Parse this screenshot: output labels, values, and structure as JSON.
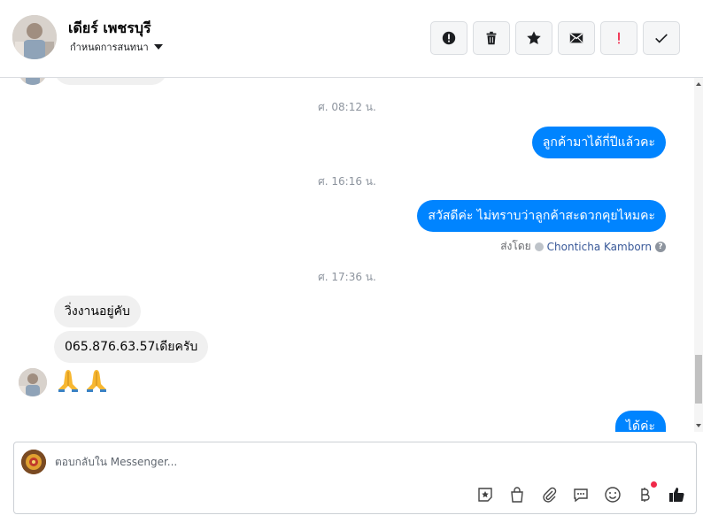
{
  "header": {
    "title": "เดียร์ เพชรบุรี",
    "subtitle": "กำหนดการสนทนา",
    "actions": [
      {
        "name": "alert-icon"
      },
      {
        "name": "trash-icon"
      },
      {
        "name": "star-icon"
      },
      {
        "name": "mail-icon"
      },
      {
        "name": "exclamation-icon"
      },
      {
        "name": "check-icon"
      }
    ]
  },
  "chat": {
    "timestamps": [
      "ศ. 08:12 น.",
      "ศ. 16:16 น.",
      "ศ. 17:36 น."
    ],
    "messages": {
      "out1": "ลูกค้ามาได้กี่ปีแล้วคะ",
      "out2": "สวัสดีค่ะ ไม่ทราบว่าลูกค้าสะดวกคุยไหมคะ",
      "in1": "วิ่งงานอยู่คับ",
      "in2": "065.876.63.57เดียครับ",
      "out3": "ได้ค่ะ"
    },
    "sent_by": {
      "prefix": "ส่งโดย",
      "name": "Chonticha Kamborn",
      "help": "?"
    },
    "emoji_name": "folded-hands-icon"
  },
  "composer": {
    "placeholder": "ตอบกลับใน Messenger...",
    "icons": [
      "sticker-icon",
      "shopping-bag-icon",
      "attachment-icon",
      "chat-bubble-icon",
      "emoji-icon",
      "baht-icon",
      "like-icon"
    ]
  },
  "colors": {
    "outgoing": "#0084ff",
    "incoming": "#f0f0f0",
    "alert_red": "#f02849"
  }
}
